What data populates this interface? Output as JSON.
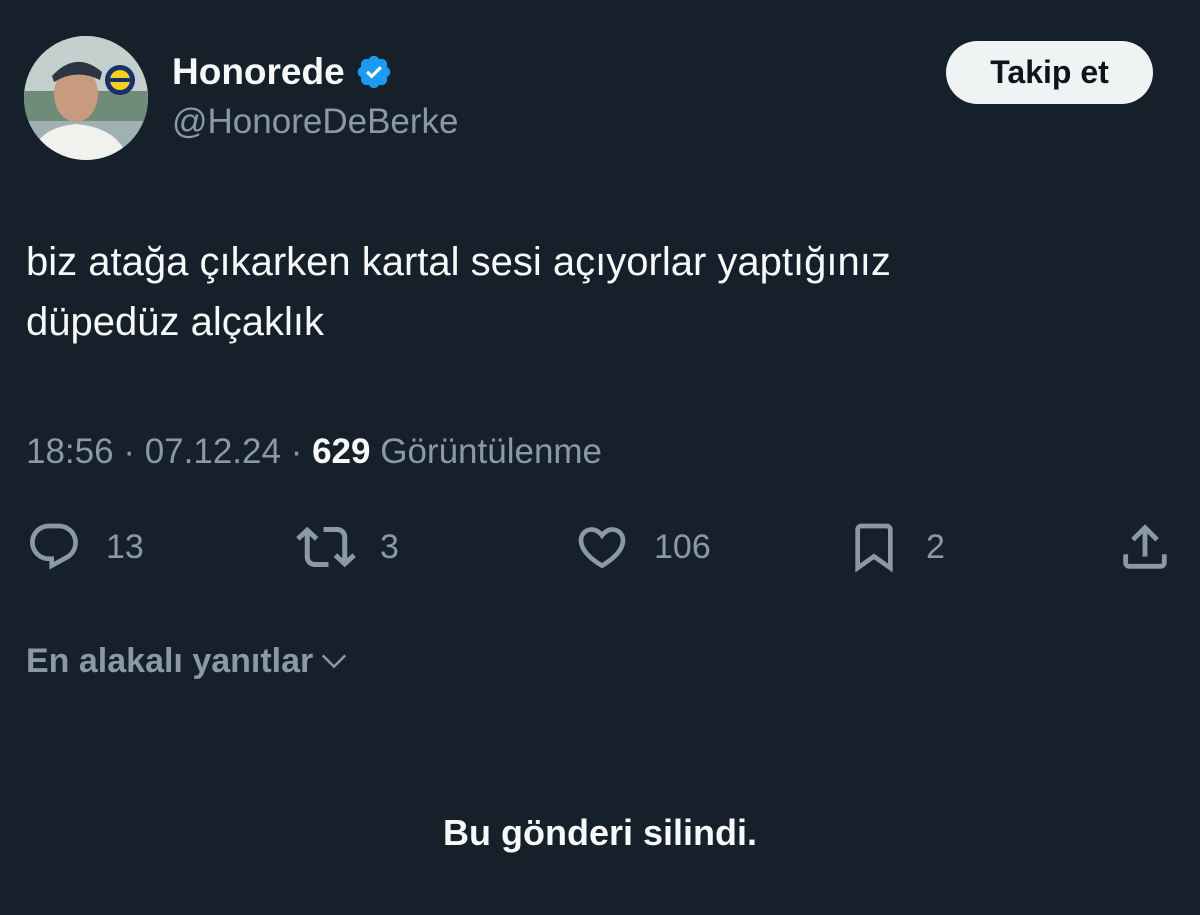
{
  "author": {
    "display_name": "Honorede",
    "handle": "@HonoreDeBerke",
    "verified": true,
    "avatar_icon": "profile-photo-avatar"
  },
  "follow_button": {
    "label": "Takip et"
  },
  "tweet": {
    "text": "biz atağa çıkarken kartal sesi açıyorlar yaptığınız\ndüpedüz alçaklık"
  },
  "meta": {
    "time": "18:56",
    "separator": "·",
    "date": "07.12.24",
    "views_count": "629",
    "views_label": "Görüntülenme"
  },
  "actions": {
    "replies": {
      "icon": "reply-icon",
      "count": "13"
    },
    "retweets": {
      "icon": "retweet-icon",
      "count": "3"
    },
    "likes": {
      "icon": "heart-icon",
      "count": "106"
    },
    "bookmarks": {
      "icon": "bookmark-icon",
      "count": "2"
    },
    "share": {
      "icon": "share-icon"
    }
  },
  "replies_sort": {
    "label": "En alakalı yanıtlar"
  },
  "deleted_notice": "Bu gönderi silindi.",
  "colors": {
    "background": "#15202b",
    "text_primary": "#f7f9f9",
    "text_secondary": "#8b98a5",
    "verified_blue": "#1d9bf0",
    "button_bg": "#eff3f4"
  }
}
